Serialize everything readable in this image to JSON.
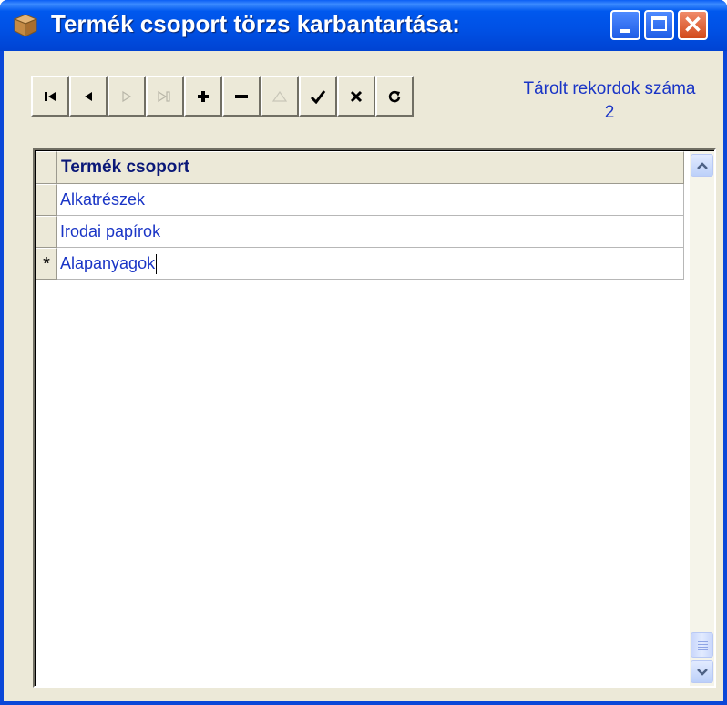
{
  "window": {
    "title": "Termék csoport törzs karbantartása:"
  },
  "toolbar": {
    "buttons": [
      {
        "name": "first-record",
        "enabled": true
      },
      {
        "name": "prior-record",
        "enabled": true
      },
      {
        "name": "next-record",
        "enabled": false
      },
      {
        "name": "last-record",
        "enabled": false
      },
      {
        "name": "insert-record",
        "enabled": true
      },
      {
        "name": "delete-record",
        "enabled": true
      },
      {
        "name": "edit-record",
        "enabled": false
      },
      {
        "name": "post-record",
        "enabled": true
      },
      {
        "name": "cancel-edit",
        "enabled": true
      },
      {
        "name": "refresh-data",
        "enabled": true
      }
    ]
  },
  "records": {
    "label": "Tárolt rekordok száma",
    "count": "2"
  },
  "grid": {
    "column_header": "Termék csoport",
    "rows": [
      {
        "indicator": "",
        "value": "Alkatrészek"
      },
      {
        "indicator": "",
        "value": "Irodai papírok"
      },
      {
        "indicator": "*",
        "value": "Alapanyagok"
      }
    ]
  },
  "colors": {
    "title_bar": "#0054E3",
    "text_blue": "#1A35C6",
    "header_text": "#0A1878",
    "face": "#ECE9D8"
  }
}
